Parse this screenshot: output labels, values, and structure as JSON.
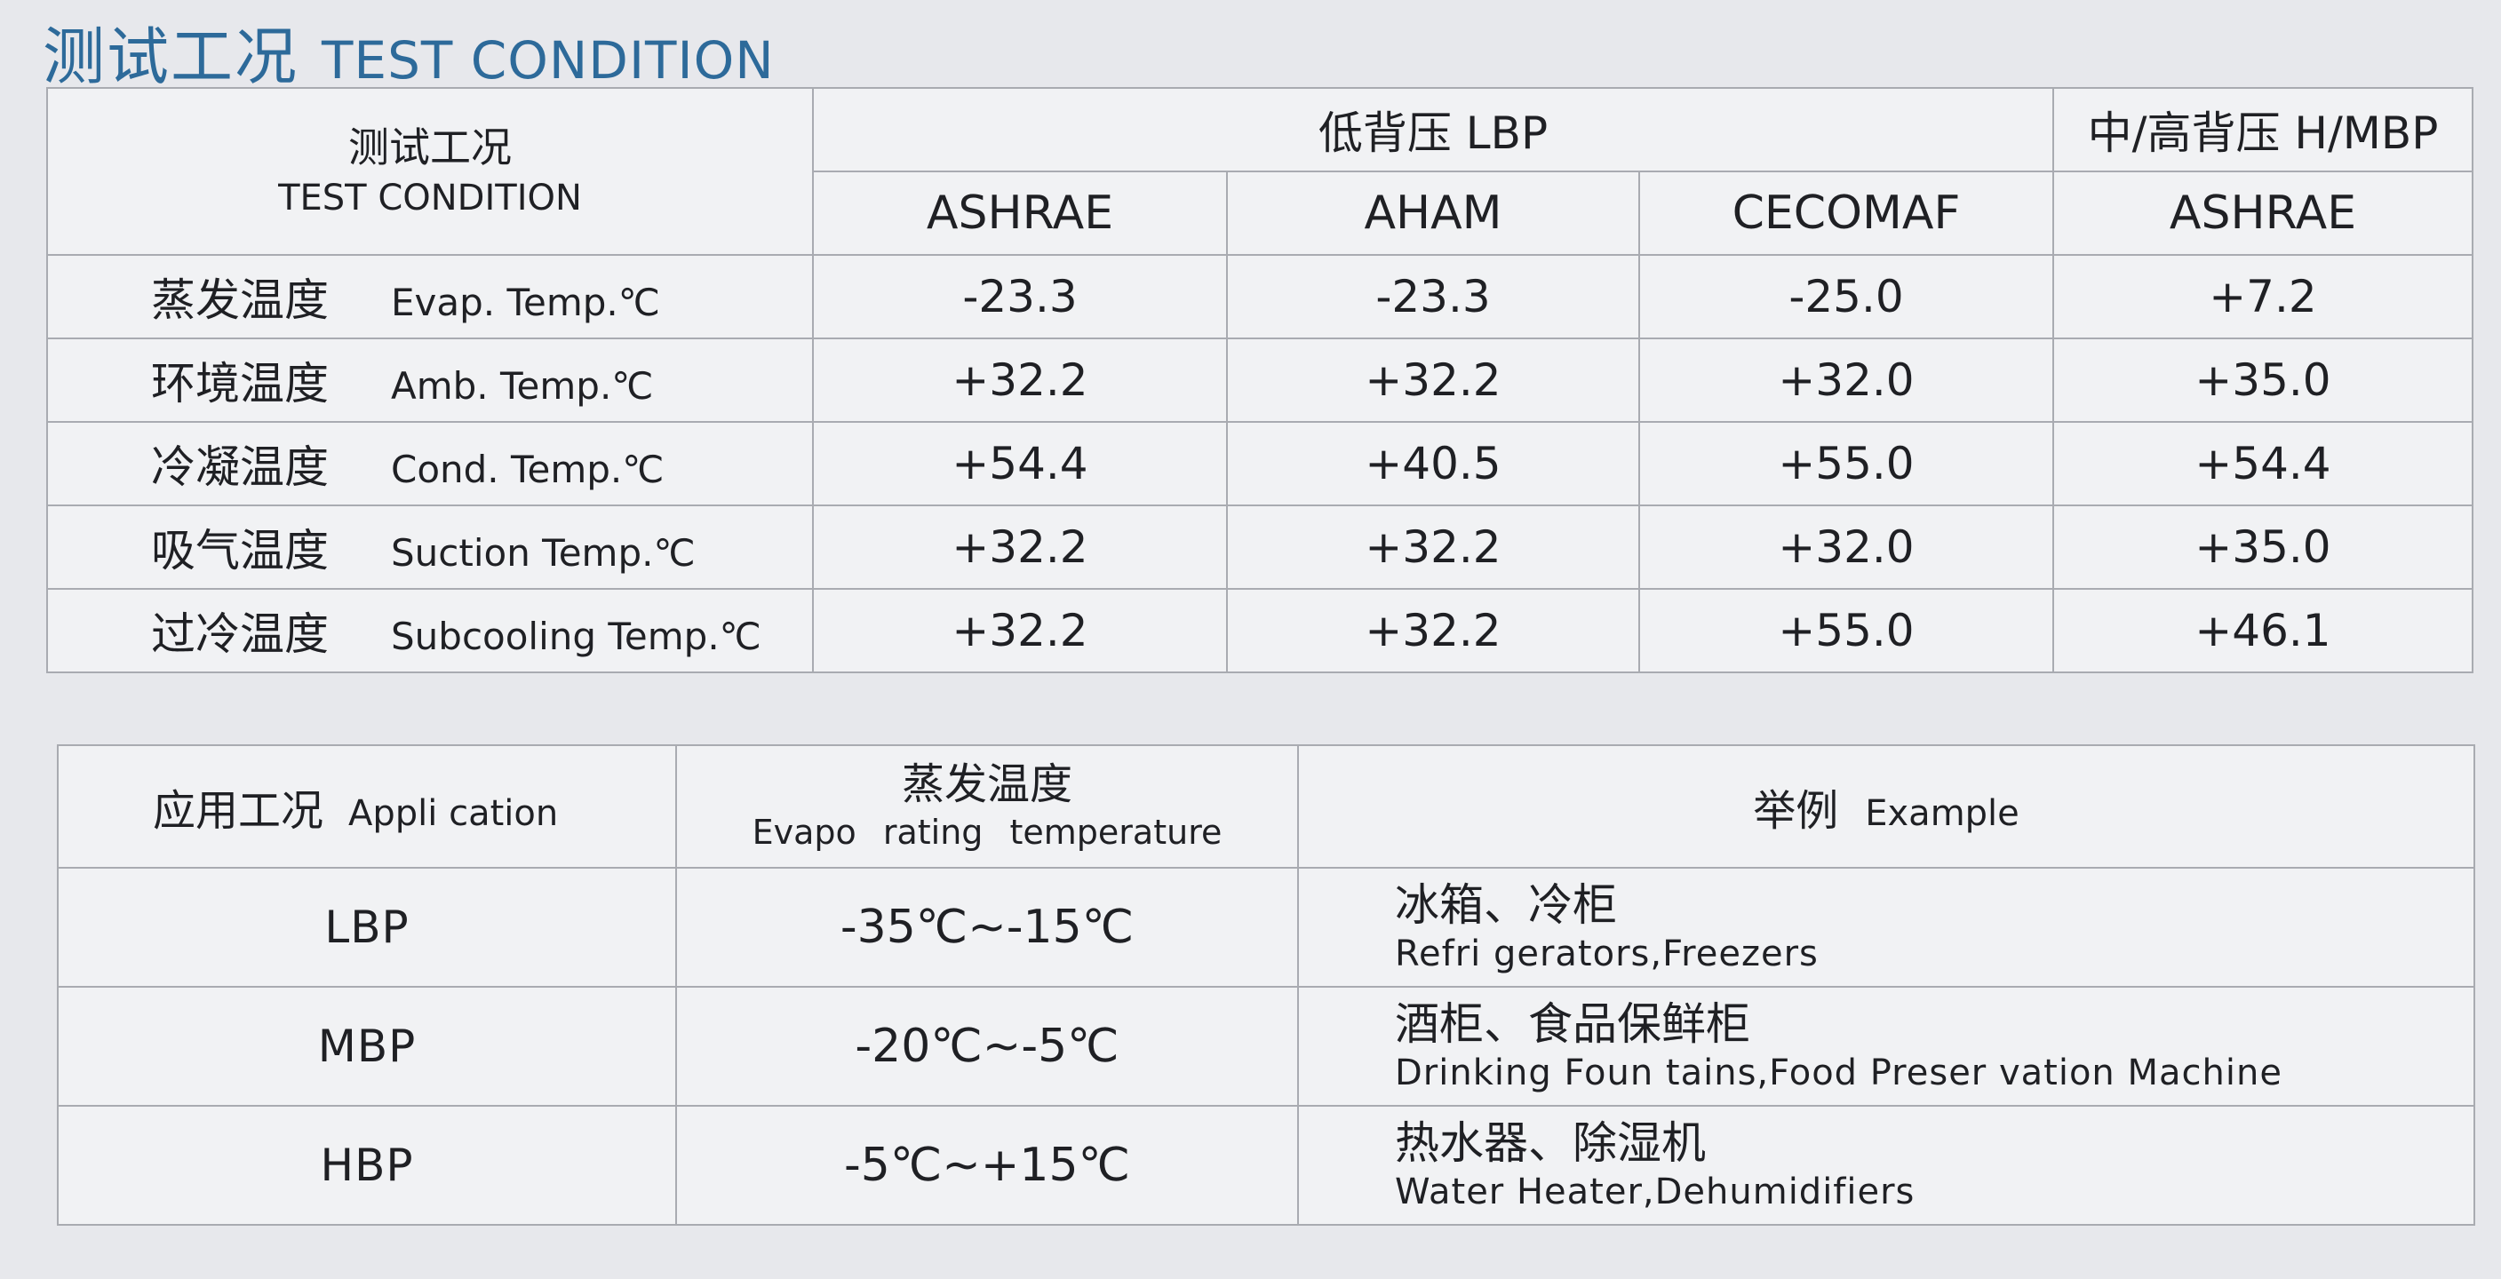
{
  "title": {
    "zh": "测试工况",
    "en": "TEST CONDITION"
  },
  "test_table": {
    "corner_zh": "测试工况",
    "corner_en": "TEST CONDITION",
    "group_lbp": "低背压 LBP",
    "group_hmbp": "中/高背压  H/MBP",
    "standards": [
      "ASHRAE",
      "AHAM",
      "CECOMAF",
      "ASHRAE"
    ],
    "rows": [
      {
        "zh": "蒸发温度",
        "en": "Evap. Temp.℃",
        "values": [
          "-23.3",
          "-23.3",
          "-25.0",
          "+7.2"
        ]
      },
      {
        "zh": "环境温度",
        "en": "Amb. Temp.℃",
        "values": [
          "+32.2",
          "+32.2",
          "+32.0",
          "+35.0"
        ]
      },
      {
        "zh": "冷凝温度",
        "en": "Cond. Temp.℃",
        "values": [
          "+54.4",
          "+40.5",
          "+55.0",
          "+54.4"
        ]
      },
      {
        "zh": "吸气温度",
        "en": "Suction  Temp.℃",
        "values": [
          "+32.2",
          "+32.2",
          "+32.0",
          "+35.0"
        ]
      },
      {
        "zh": "过冷温度",
        "en": "Subcooling Temp.℃",
        "values": [
          "+32.2",
          "+32.2",
          "+55.0",
          "+46.1"
        ]
      }
    ]
  },
  "app_table": {
    "header_app_zh": "应用工况",
    "header_app_en": "Appli cation",
    "header_evap_zh": "蒸发温度",
    "header_evap_en": "Evapo  rating  temperature",
    "header_example_zh": "举例",
    "header_example_en": "Example",
    "rows": [
      {
        "condition": "LBP",
        "range": "-35℃~-15℃",
        "example_zh": "冰箱、冷柜",
        "example_en": "Refri gerators,Freezers"
      },
      {
        "condition": "MBP",
        "range": "-20℃~-5℃",
        "example_zh": "酒柜、食品保鲜柜",
        "example_en": "Drinking Foun tains,Food Preser vation Machine"
      },
      {
        "condition": "HBP",
        "range": "-5℃~+15℃",
        "example_zh": "热水器、除湿机",
        "example_en": "Water Heater,Dehumidifiers"
      }
    ]
  }
}
